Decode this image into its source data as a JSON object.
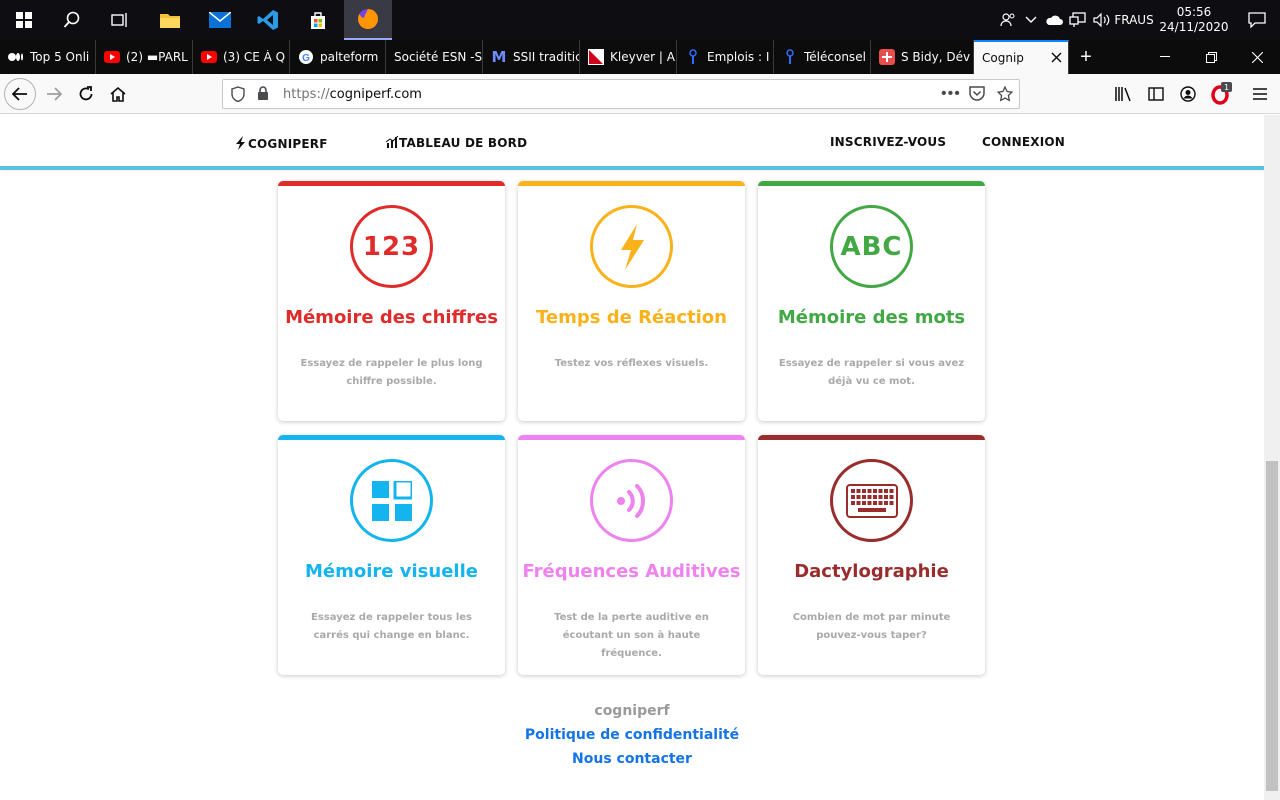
{
  "taskbar": {
    "lang_top": "FRA",
    "lang_bottom": "US",
    "time": "05:56",
    "date": "24/11/2020"
  },
  "tabs": [
    {
      "label": "Top 5 Onli",
      "icon": "medium-icon",
      "color": "#ffffff"
    },
    {
      "label": "(2) ▬PARL",
      "icon": "youtube-icon",
      "color": "#ff0000"
    },
    {
      "label": "(3) CE À Q",
      "icon": "youtube-icon",
      "color": "#ff0000"
    },
    {
      "label": "palteform",
      "icon": "google-icon",
      "color": "#4285f4"
    },
    {
      "label": "Société ESN -S",
      "icon": "none",
      "color": ""
    },
    {
      "label": "SSII traditic",
      "icon": "m-icon",
      "color": "#6c8cff"
    },
    {
      "label": "Kleyver | A",
      "icon": "kleyver-icon",
      "color": "#d0021b"
    },
    {
      "label": "Emplois : I",
      "icon": "info-icon",
      "color": "#2f6bff"
    },
    {
      "label": "Téléconsel",
      "icon": "info-icon",
      "color": "#2f6bff"
    },
    {
      "label": "S Bidy, Dév",
      "icon": "bidy-icon",
      "color": "#e94e4e"
    },
    {
      "label": "Cognip",
      "icon": "none",
      "color": "",
      "active": true
    }
  ],
  "navbar": {
    "url_prefix": "https://",
    "url_host": "cogniperf.com"
  },
  "site": {
    "brand": "COGNIPERF",
    "dashboard": "TABLEAU DE BORD",
    "signup": "INSCRIVEZ-VOUS",
    "login": "CONNEXION"
  },
  "cards": [
    {
      "title": "Mémoire des chiffres",
      "desc": "Essayez de rappeler le plus long chiffre possible.",
      "icon_text": "123",
      "color": "#e02b2b"
    },
    {
      "title": "Temps de Réaction",
      "desc": "Testez vos réflexes visuels.",
      "icon_text": "",
      "color": "#f9b21a"
    },
    {
      "title": "Mémoire des mots",
      "desc": "Essayez de rappeler si vous avez déjà vu ce mot.",
      "icon_text": "ABC",
      "color": "#42a844"
    },
    {
      "title": "Mémoire visuelle",
      "desc": "Essayez de rappeler tous les carrés qui change en blanc.",
      "icon_text": "",
      "color": "#14b4ee"
    },
    {
      "title": "Fréquences Auditives",
      "desc": "Test de la perte auditive en écoutant un son à haute fréquence.",
      "icon_text": "",
      "color": "#ee82ee"
    },
    {
      "title": "Dactylographie",
      "desc": "Combien de mot par minute pouvez-vous taper?",
      "icon_text": "",
      "color": "#992d2d"
    }
  ],
  "footer": {
    "brand": "cogniperf",
    "privacy": "Politique de confidentialité",
    "contact": "Nous contacter"
  }
}
